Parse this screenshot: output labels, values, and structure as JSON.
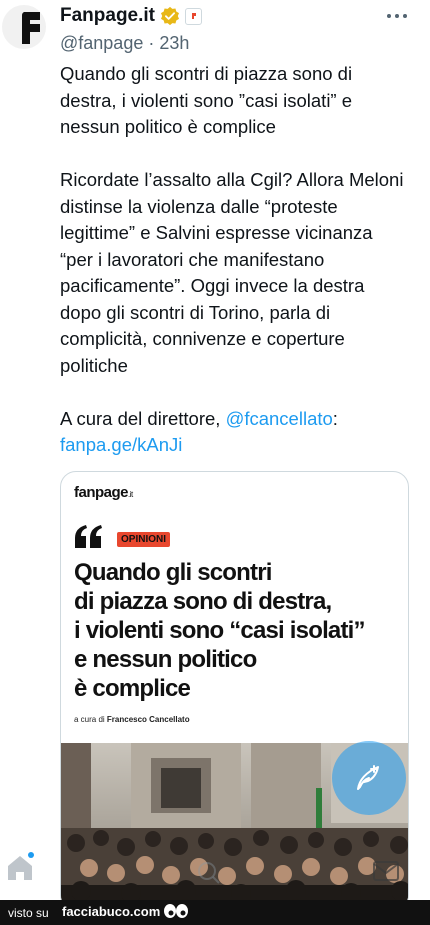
{
  "tweet": {
    "author_name": "Fanpage.it",
    "handle": "@fanpage",
    "separator": "·",
    "time": "23h",
    "paragraphs": [
      "Quando gli scontri di piazza sono di destra, i violenti sono ”casi isolati” e nessun politico è complice",
      "Ricordate l’assalto alla Cgil? Allora Meloni distinse la violenza dalle “proteste legittime” e Salvini espresse vicinanza “per i lavoratori che manifestano pacificamente”. Oggi invece la destra dopo gli scontri di Torino, parla di complicità, connivenze e coperture politiche"
    ],
    "credit_prefix": "A cura del direttore, ",
    "mention": "@fcancellato",
    "credit_suffix": ":",
    "link": "fanpa.ge/kAnJi"
  },
  "card": {
    "logo": "fanpage",
    "logo_suffix": ".it",
    "badge": "OPINIONI",
    "headline_lines": [
      "Quando gli scontri",
      "di piazza sono di destra,",
      "i violenti sono “casi isolati”",
      "e nessun politico",
      "è complice"
    ],
    "byline_prefix": "a cura di ",
    "byline_author": "Francesco Cancellato"
  },
  "icons": {
    "verified": "verified-badge-icon",
    "affiliate": "affiliate-badge-icon",
    "more": "more-options-icon",
    "compose": "compose-tweet-icon",
    "home": "home-icon",
    "quote": "quote-icon"
  },
  "colors": {
    "link": "#1d9bf0",
    "verified": "#e8b818",
    "badge": "#e8472e",
    "text": "#0f1419",
    "muted": "#536471"
  },
  "footer": {
    "visto": "visto su",
    "site": "facciabuco.com"
  }
}
